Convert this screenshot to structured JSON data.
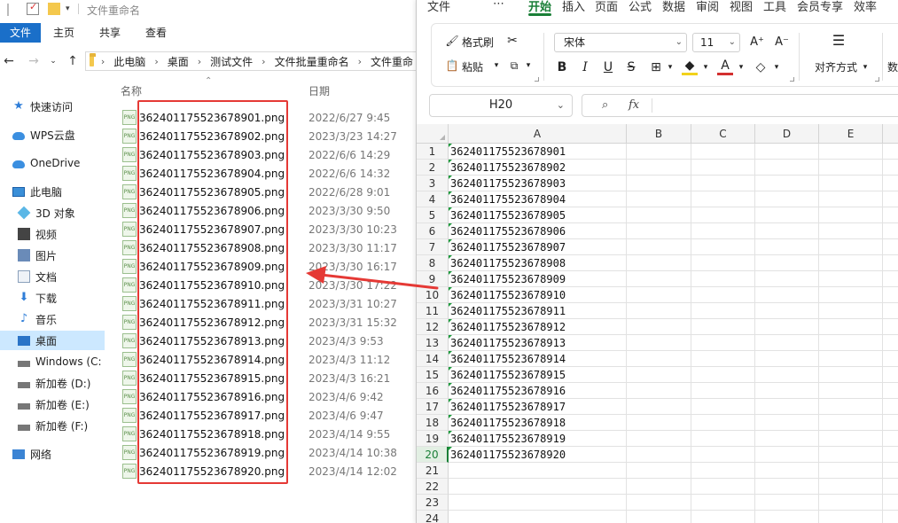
{
  "explorer": {
    "window_title": "文件重命名",
    "ribbon_tabs": [
      "文件",
      "主页",
      "共享",
      "查看"
    ],
    "breadcrumbs": [
      "此电脑",
      "桌面",
      "测试文件",
      "文件批量重命名",
      "文件重命"
    ],
    "columns": {
      "name": "名称",
      "date": "日期"
    },
    "nav_items": [
      {
        "label": "快速访问",
        "icon": "star-icon"
      },
      {
        "label": "WPS云盘",
        "icon": "cloud-icon"
      },
      {
        "label": "OneDrive",
        "icon": "cloud-icon"
      },
      {
        "label": "此电脑",
        "icon": "computer-icon"
      },
      {
        "label": "3D 对象",
        "icon": "cube-icon"
      },
      {
        "label": "视频",
        "icon": "video-icon"
      },
      {
        "label": "图片",
        "icon": "picture-icon"
      },
      {
        "label": "文档",
        "icon": "document-icon"
      },
      {
        "label": "下载",
        "icon": "download-icon"
      },
      {
        "label": "音乐",
        "icon": "music-icon"
      },
      {
        "label": "桌面",
        "icon": "desktop-icon"
      },
      {
        "label": "Windows (C:",
        "icon": "drive-icon"
      },
      {
        "label": "新加卷 (D:)",
        "icon": "drive-icon"
      },
      {
        "label": "新加卷 (E:)",
        "icon": "drive-icon"
      },
      {
        "label": "新加卷 (F:)",
        "icon": "drive-icon"
      },
      {
        "label": "网络",
        "icon": "network-icon"
      }
    ],
    "selected_nav": "桌面",
    "file_icon_label": "PNG",
    "files": [
      {
        "name": "362401175523678901.png",
        "date": "2022/6/27 9:45"
      },
      {
        "name": "362401175523678902.png",
        "date": "2023/3/23 14:27"
      },
      {
        "name": "362401175523678903.png",
        "date": "2022/6/6 14:29"
      },
      {
        "name": "362401175523678904.png",
        "date": "2022/6/6 14:32"
      },
      {
        "name": "362401175523678905.png",
        "date": "2022/6/28 9:01"
      },
      {
        "name": "362401175523678906.png",
        "date": "2023/3/30 9:50"
      },
      {
        "name": "362401175523678907.png",
        "date": "2023/3/30 10:23"
      },
      {
        "name": "362401175523678908.png",
        "date": "2023/3/30 11:17"
      },
      {
        "name": "362401175523678909.png",
        "date": "2023/3/30 16:17"
      },
      {
        "name": "362401175523678910.png",
        "date": "2023/3/30 17:22"
      },
      {
        "name": "362401175523678911.png",
        "date": "2023/3/31 10:27"
      },
      {
        "name": "362401175523678912.png",
        "date": "2023/3/31 15:32"
      },
      {
        "name": "362401175523678913.png",
        "date": "2023/4/3 9:53"
      },
      {
        "name": "362401175523678914.png",
        "date": "2023/4/3 11:12"
      },
      {
        "name": "362401175523678915.png",
        "date": "2023/4/3 16:21"
      },
      {
        "name": "362401175523678916.png",
        "date": "2023/4/6 9:42"
      },
      {
        "name": "362401175523678917.png",
        "date": "2023/4/6 9:47"
      },
      {
        "name": "362401175523678918.png",
        "date": "2023/4/14 9:55"
      },
      {
        "name": "362401175523678919.png",
        "date": "2023/4/14 10:38"
      },
      {
        "name": "362401175523678920.png",
        "date": "2023/4/14 12:02"
      }
    ]
  },
  "spreadsheet": {
    "menu": [
      "文件",
      "⋯",
      "开始",
      "插入",
      "页面",
      "公式",
      "数据",
      "审阅",
      "视图",
      "工具",
      "会员专享",
      "效率"
    ],
    "active_menu": "开始",
    "toolbar": {
      "format_painter": "格式刷",
      "paste": "粘贴",
      "font_name": "宋体",
      "font_size": "11",
      "align": "对齐方式",
      "number_partial": "数"
    },
    "name_box": "H20",
    "fx_label": "fx",
    "columns": [
      "A",
      "B",
      "C",
      "D",
      "E"
    ],
    "row_numbers": [
      "1",
      "2",
      "3",
      "4",
      "5",
      "6",
      "7",
      "8",
      "9",
      "10",
      "11",
      "12",
      "13",
      "14",
      "15",
      "16",
      "17",
      "18",
      "19",
      "20",
      "21",
      "22",
      "23",
      "24"
    ],
    "active_row": "20",
    "col_a_values": [
      "362401175523678901",
      "362401175523678902",
      "362401175523678903",
      "362401175523678904",
      "362401175523678905",
      "362401175523678906",
      "362401175523678907",
      "362401175523678908",
      "362401175523678909",
      "362401175523678910",
      "362401175523678911",
      "362401175523678912",
      "362401175523678913",
      "362401175523678914",
      "362401175523678915",
      "362401175523678916",
      "362401175523678917",
      "362401175523678918",
      "362401175523678919",
      "362401175523678920"
    ]
  },
  "colors": {
    "highlight_box": "#e53935",
    "arrow": "#e53935",
    "accent_green": "#1a7f37",
    "explorer_file_tab": "#1a6fc9"
  }
}
